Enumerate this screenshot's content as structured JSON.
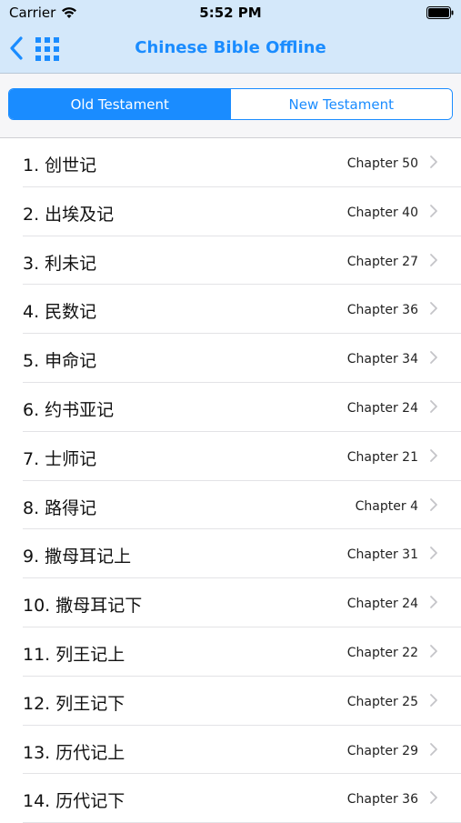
{
  "status": {
    "carrier": "Carrier",
    "time": "5:52 PM"
  },
  "nav": {
    "title": "Chinese Bible Offline"
  },
  "segments": {
    "old": "Old Testament",
    "new": "New Testament",
    "selected": "old"
  },
  "books": [
    {
      "title": "1. 创世记",
      "chapter": "Chapter 50"
    },
    {
      "title": "2. 出埃及记",
      "chapter": "Chapter 40"
    },
    {
      "title": "3. 利未记",
      "chapter": "Chapter 27"
    },
    {
      "title": "4. 民数记",
      "chapter": "Chapter 36"
    },
    {
      "title": "5. 申命记",
      "chapter": "Chapter 34"
    },
    {
      "title": "6. 约书亚记",
      "chapter": "Chapter 24"
    },
    {
      "title": "7. 士师记",
      "chapter": "Chapter 21"
    },
    {
      "title": "8. 路得记",
      "chapter": "Chapter 4"
    },
    {
      "title": "9. 撒母耳记上",
      "chapter": "Chapter 31"
    },
    {
      "title": "10. 撒母耳记下",
      "chapter": "Chapter 24"
    },
    {
      "title": "11. 列王记上",
      "chapter": "Chapter 22"
    },
    {
      "title": "12. 列王记下",
      "chapter": "Chapter 25"
    },
    {
      "title": "13. 历代记上",
      "chapter": "Chapter 29"
    },
    {
      "title": "14. 历代记下",
      "chapter": "Chapter 36"
    }
  ],
  "icons": {
    "wifi": "wifi-icon",
    "battery": "battery-icon",
    "back": "chevron-left-icon",
    "grid": "grid-icon",
    "disclosure": "chevron-right-icon"
  },
  "colors": {
    "accent": "#1a8cff",
    "header_bg": "#d4e8fa"
  }
}
